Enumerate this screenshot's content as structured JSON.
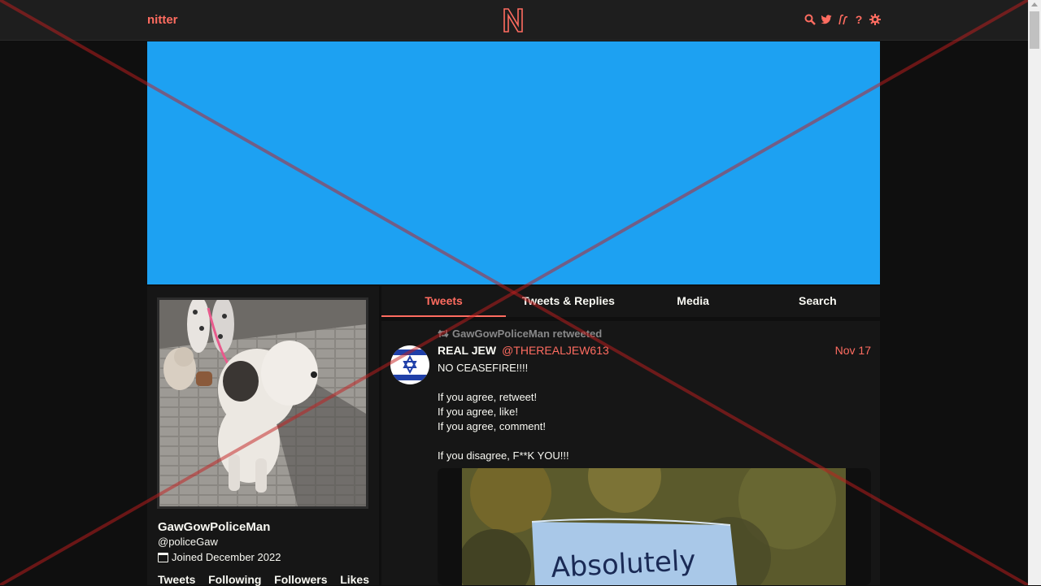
{
  "nav": {
    "brand": "nitter",
    "logo_letter": "N",
    "icons": [
      "search-icon",
      "twitter-bird-icon",
      "rss-icon",
      "help-icon",
      "gear-icon"
    ],
    "help_glyph": "?"
  },
  "colors": {
    "accent": "#ff6c60",
    "banner": "#1da1f2",
    "background": "#0f0f0f",
    "panel": "#161616"
  },
  "profile": {
    "fullname": "GawGowPoliceMan",
    "username": "@policeGaw",
    "joined": "Joined December 2022",
    "stats": [
      "Tweets",
      "Following",
      "Followers",
      "Likes"
    ]
  },
  "tabs": [
    {
      "label": "Tweets",
      "active": true
    },
    {
      "label": "Tweets & Replies",
      "active": false
    },
    {
      "label": "Media",
      "active": false
    },
    {
      "label": "Search",
      "active": false
    }
  ],
  "tweet": {
    "retweet_header": "GawGowPoliceMan retweeted",
    "fullname": "REAL JEW",
    "username": "@THEREALJEW613",
    "date": "Nov 17",
    "lines": [
      "NO CEASEFIRE!!!!",
      "",
      "If you agree, retweet!",
      "If you agree, like!",
      "If you agree, comment!",
      "",
      "If you disagree, F**K YOU!!!"
    ],
    "media_sign_text": "Absolutely"
  }
}
